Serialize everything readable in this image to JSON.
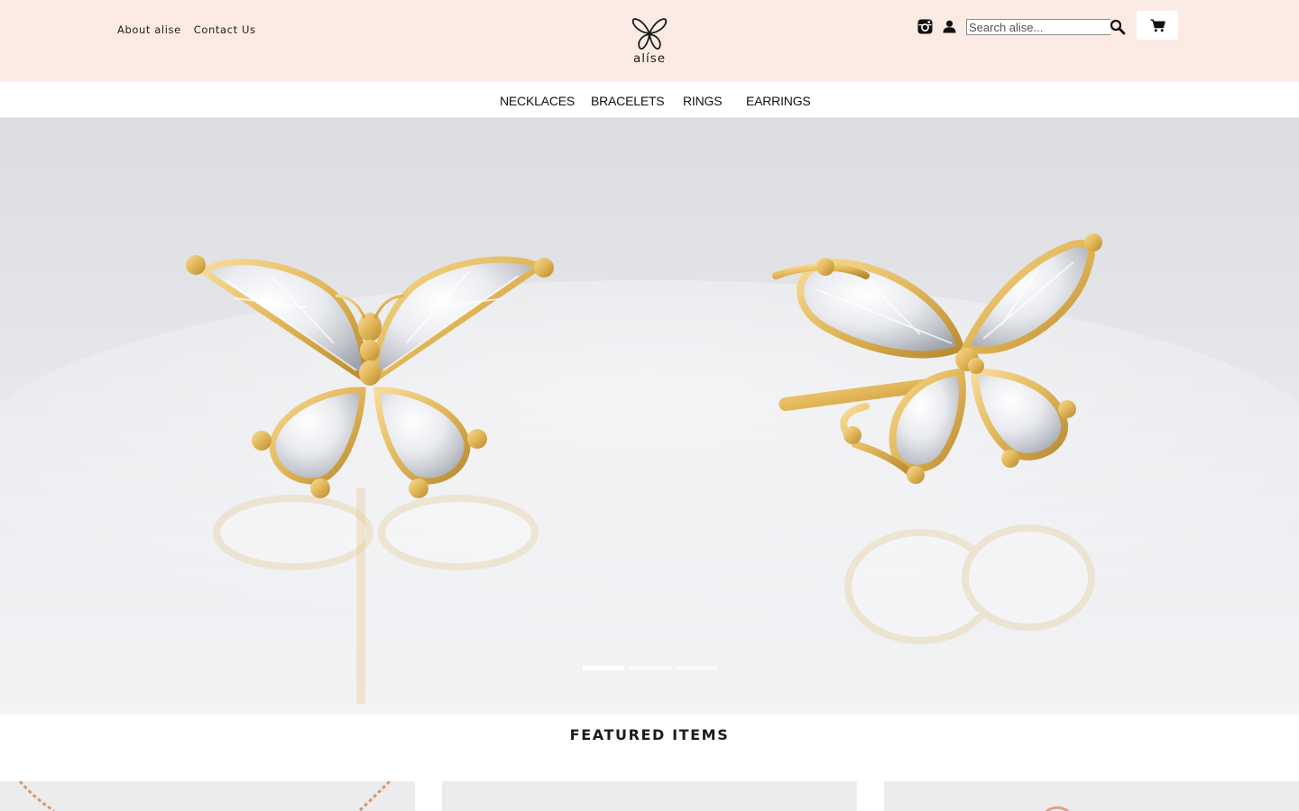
{
  "header": {
    "links": [
      "About alise",
      "Contact Us"
    ],
    "logo_text": "alíse",
    "icons": {
      "instagram": "instagram-icon",
      "account": "user-icon",
      "search": "search-icon",
      "cart": "cart-icon"
    },
    "search": {
      "placeholder": "Search alise...",
      "value": ""
    }
  },
  "nav": {
    "categories": [
      "NECKLACES",
      "BRACELETS",
      "RINGS",
      "EARRINGS"
    ]
  },
  "hero": {
    "slide_count": 3,
    "active_slide": 1
  },
  "featured": {
    "title": "FEATURED ITEMS",
    "card_count": 3
  },
  "colors": {
    "topbar_bg": "#fbebe4",
    "gold": "#e2b95c",
    "text": "#111111"
  }
}
